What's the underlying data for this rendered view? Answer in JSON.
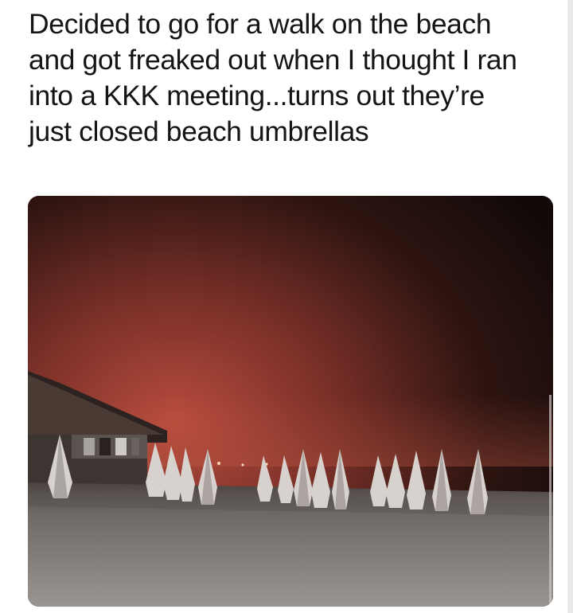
{
  "post": {
    "caption_lines": [
      "Decided to go for a walk on the beach",
      "and got freaked out when I thought I ran",
      "into a KKK meeting...turns out they’re",
      "just closed beach umbrellas"
    ]
  },
  "photo": {
    "subject": "night-beach-closed-umbrellas",
    "sky_glow_color": "#b0463a",
    "umbrella_color": "#d8d2cf",
    "sand_color": "#8a8580"
  }
}
